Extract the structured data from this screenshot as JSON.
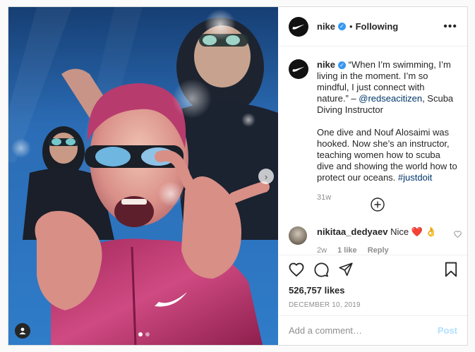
{
  "header": {
    "username": "nike",
    "verified_glyph": "✓",
    "separator": "•",
    "follow_status": "Following",
    "more_icon": "ellipsis-icon",
    "more_label": "•••"
  },
  "media": {
    "next_icon": "chevron-right-icon",
    "next_glyph": "›",
    "carousel_dots": 2,
    "active_dot": 0,
    "tag_icon": "user-tag-icon"
  },
  "caption": {
    "username": "nike",
    "quote": "“When I’m swimming, I’m living in the moment. I’m so mindful, I just connect with nature.” –",
    "mention": "@redseacitizen",
    "credit": ", Scuba Diving Instructor",
    "paragraph": "One dive and Nouf Alosaimi was hooked. Now she’s an instructor, teaching women how to scuba dive and showing the world how to protect our oceans.",
    "hashtag": "#justdoit",
    "age": "31w"
  },
  "load_more_icon": "plus-circle-icon",
  "comment": {
    "username": "nikitaa_dedyaev",
    "text": "Nice ❤️ 👌",
    "age": "2w",
    "likes": "1 like",
    "reply": "Reply"
  },
  "actions": {
    "like_icon": "heart-icon",
    "comment_icon": "comment-icon",
    "share_icon": "paper-plane-icon",
    "save_icon": "bookmark-icon"
  },
  "likes_count": "526,757 likes",
  "date": "DECEMBER 10, 2019",
  "add_comment": {
    "placeholder": "Add a comment…",
    "post_label": "Post"
  },
  "colors": {
    "verified": "#3897f0",
    "link": "#00376b",
    "post_button_disabled": "#b2dffc",
    "heart_red": "#ed4956"
  }
}
